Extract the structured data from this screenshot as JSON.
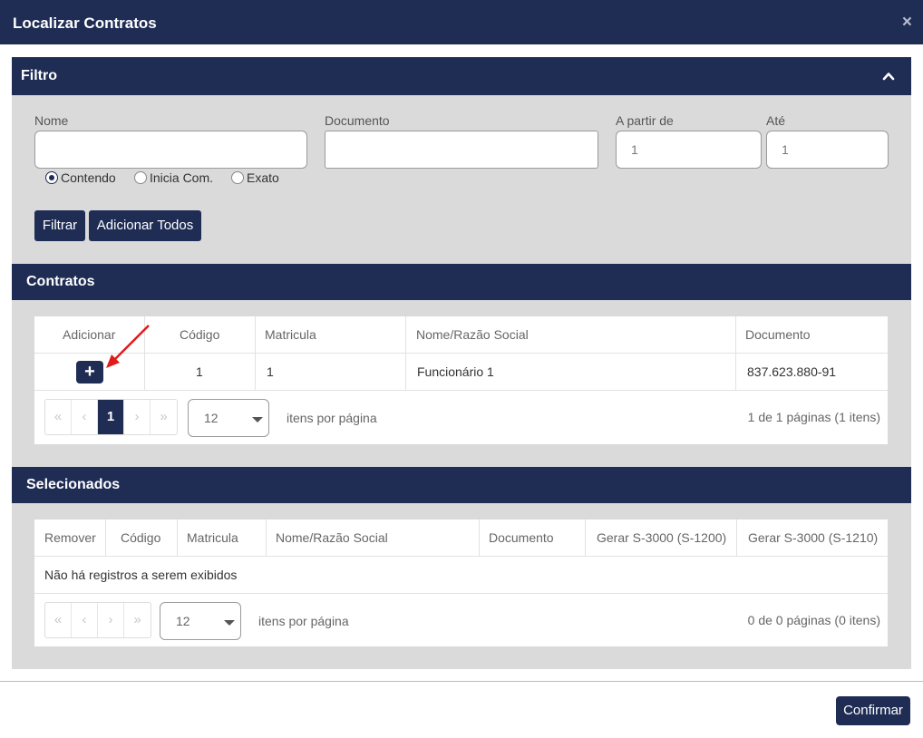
{
  "dialog": {
    "title": "Localizar Contratos",
    "close_icon": "×"
  },
  "filtro": {
    "header": "Filtro",
    "collapse_icon": "chevron-up-icon",
    "nome_label": "Nome",
    "nome_value": "",
    "documento_label": "Documento",
    "documento_value": "",
    "a_partir_label": "A partir de",
    "a_partir_value": "1",
    "ate_label": "Até",
    "ate_value": "1",
    "radio_options": [
      "Contendo",
      "Inicia Com.",
      "Exato"
    ],
    "radio_selected": "Contendo",
    "filtrar_button": "Filtrar",
    "adicionar_todos_button": "Adicionar Todos"
  },
  "contratos": {
    "header": "Contratos",
    "columns": [
      "Adicionar",
      "Código",
      "Matricula",
      "Nome/Razão Social",
      "Documento"
    ],
    "rows": [
      {
        "add_icon": "+",
        "codigo": "1",
        "matricula": "1",
        "nome": "Funcionário 1",
        "documento": "837.623.880-91"
      }
    ],
    "pager": {
      "first": "«",
      "prev": "‹",
      "current_page": "1",
      "next": "›",
      "last": "»",
      "page_size": "12",
      "per_page_label": "itens por página",
      "info": "1 de 1 páginas (1 itens)"
    }
  },
  "selecionados": {
    "header": "Selecionados",
    "columns": [
      "Remover",
      "Código",
      "Matricula",
      "Nome/Razão Social",
      "Documento",
      "Gerar S-3000 (S-1200)",
      "Gerar S-3000 (S-1210)"
    ],
    "empty_message": "Não há registros a serem exibidos",
    "pager": {
      "first": "«",
      "prev": "‹",
      "next": "›",
      "last": "»",
      "page_size": "12",
      "per_page_label": "itens por página",
      "info": "0 de 0 páginas (0 itens)"
    }
  },
  "footer": {
    "confirm_button": "Confirmar"
  },
  "colors": {
    "primary": "#1f2d55",
    "panel_bg": "#dadada",
    "annotation_arrow": "#e01b1b"
  }
}
